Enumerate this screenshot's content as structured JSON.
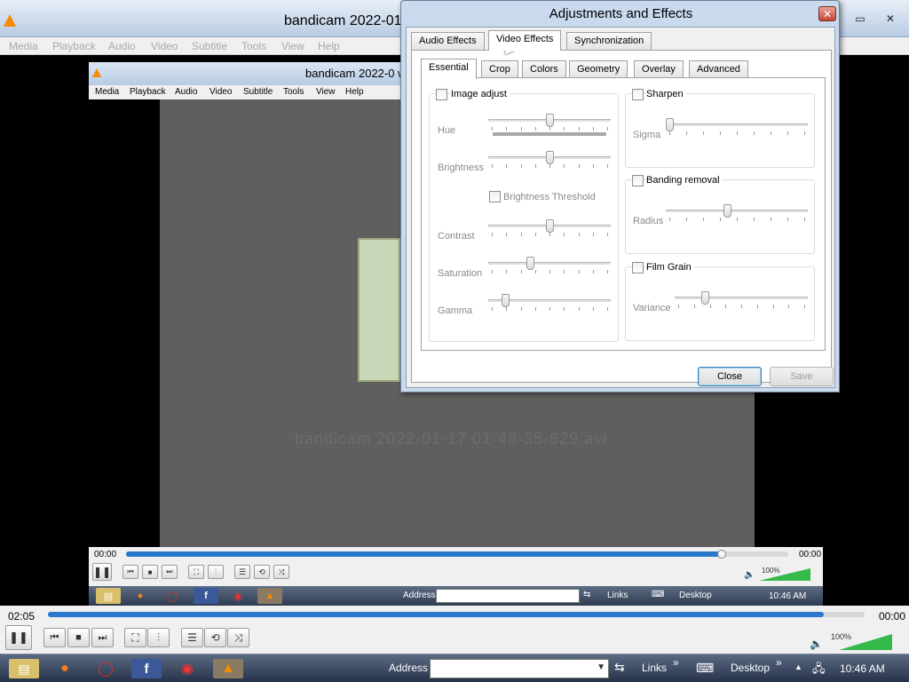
{
  "outer_window": {
    "title": "bandicam 2022-01-",
    "menu": [
      "Media",
      "Playback",
      "Audio",
      "Video",
      "Subtitle",
      "Tools",
      "View",
      "Help"
    ],
    "buttons": {
      "restore": "▭",
      "close": "✕"
    }
  },
  "inner_window": {
    "title": "bandicam 2022-0",
    "title_mid": "www",
    "menu": [
      "Media",
      "Playback",
      "Audio",
      "Video",
      "Subtitle",
      "Tools",
      "View",
      "Help"
    ],
    "overlay_text": "bandicam 2022-01-17 01-46-35-629.avi",
    "time_elapsed": "00:00",
    "time_total": "00:00",
    "seek_progress": 0.9,
    "volume_label": "100%",
    "taskbar": {
      "address_label": "Address",
      "links_label": "Links",
      "desktop_label": "Desktop",
      "clock": "10:46 AM"
    }
  },
  "outer_controls": {
    "time_elapsed": "02:05",
    "time_total": "00:00",
    "seek_progress": 0.95,
    "volume_label": "100%"
  },
  "outer_taskbar": {
    "address_label": "Address",
    "links_label": "Links",
    "desktop_label": "Desktop",
    "clock": "10:46 AM",
    "chevrons": "»"
  },
  "dialog": {
    "title": "Adjustments and Effects",
    "top_tabs": [
      "Audio Effects",
      "Video Effects",
      "Synchronization"
    ],
    "active_top_tab": "Video Effects",
    "sub_tabs": [
      "Essential",
      "Crop",
      "Colors",
      "Geometry",
      "Overlay",
      "Advanced"
    ],
    "active_sub_tab": "Essential",
    "image_adjust": {
      "label": "Image adjust",
      "checked": false,
      "hue_label": "Hue",
      "brightness_label": "Brightness",
      "brightness_threshold_label": "Brightness Threshold",
      "contrast_label": "Contrast",
      "saturation_label": "Saturation",
      "gamma_label": "Gamma",
      "hue_value": 0.5,
      "brightness_value": 0.5,
      "contrast_value": 0.5,
      "saturation_value": 0.33,
      "gamma_value": 0.12
    },
    "sharpen": {
      "label": "Sharpen",
      "checked": false,
      "sigma_label": "Sigma",
      "sigma_value": 0.0
    },
    "banding_removal": {
      "label": "Banding removal",
      "checked": false,
      "radius_label": "Radius",
      "radius_value": 0.43
    },
    "film_grain": {
      "label": "Film Grain",
      "checked": false,
      "variance_label": "Variance",
      "variance_value": 0.21
    },
    "close_label": "Close",
    "save_label": "Save"
  },
  "colors": {
    "seek_fill": "#2a78cc",
    "volume": "#35b94a",
    "dialog_frame": "#c9d9ee"
  }
}
